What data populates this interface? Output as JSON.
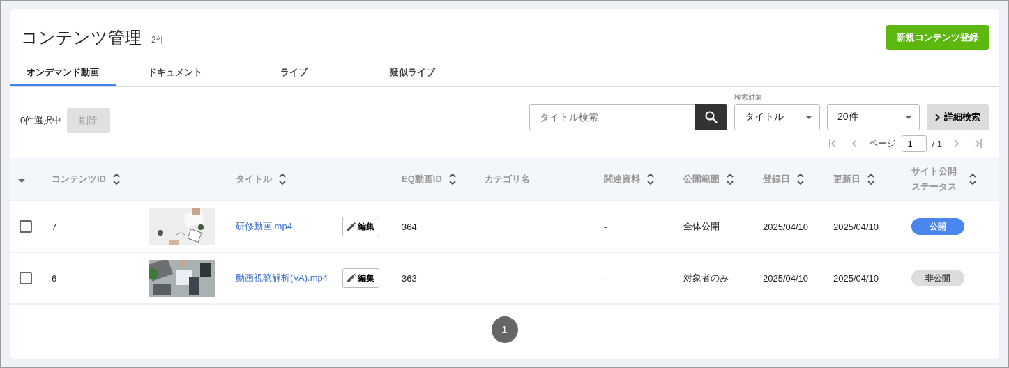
{
  "header": {
    "title": "コンテンツ管理",
    "count": "2件",
    "create_button": "新規コンテンツ登録"
  },
  "tabs": [
    {
      "label": "オンデマンド動画",
      "selected": true
    },
    {
      "label": "ドキュメント",
      "selected": false
    },
    {
      "label": "ライブ",
      "selected": false
    },
    {
      "label": "疑似ライブ",
      "selected": false
    }
  ],
  "toolbar": {
    "selection": "0件選択中",
    "delete_button": "削除",
    "delete_disabled": true,
    "search": {
      "placeholder": "タイトル検索"
    },
    "target_label": "検索対象",
    "target_select": "タイトル",
    "per_page_select": "20件",
    "advanced_button": "詳細検索"
  },
  "pager": {
    "label": "ページ",
    "page": "1",
    "total": "/ 1"
  },
  "table": {
    "columns": [
      {
        "label": "コンテンツID",
        "sortable": true
      },
      {
        "label": "タイトル",
        "sortable": true
      },
      {
        "label": "EQ動画ID",
        "sortable": true
      },
      {
        "label": "カテゴリ名",
        "sortable": false
      },
      {
        "label": "関連資料",
        "sortable": true
      },
      {
        "label": "公開範囲",
        "sortable": true
      },
      {
        "label": "登録日",
        "sortable": true
      },
      {
        "label": "更新日",
        "sortable": true
      },
      {
        "label": "サイト公開ステータス",
        "sortable": true
      }
    ],
    "rows": [
      {
        "checked": false,
        "id": "7",
        "title": "研修動画.mp4",
        "edit": "編集",
        "eq_id": "364",
        "related": "-",
        "scope": "全体公開",
        "registered": "2025/04/10",
        "updated": "2025/04/10",
        "status": {
          "label": "公開",
          "published": true
        }
      },
      {
        "checked": false,
        "id": "6",
        "title": "動画視聴解析(VA).mp4",
        "edit": "編集",
        "eq_id": "363",
        "related": "-",
        "scope": "対象者のみ",
        "registered": "2025/04/10",
        "updated": "2025/04/10",
        "status": {
          "label": "非公開",
          "published": false
        }
      }
    ]
  },
  "pagination": {
    "pages": [
      {
        "label": "1",
        "selected": true
      }
    ]
  }
}
